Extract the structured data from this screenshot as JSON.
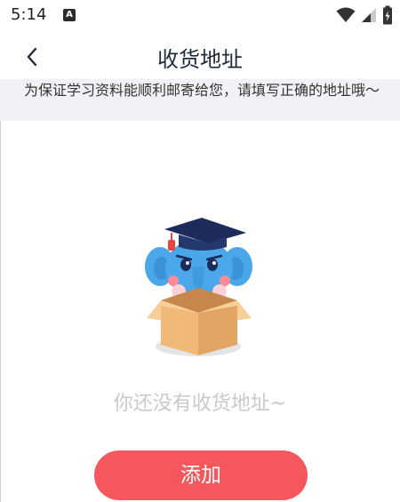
{
  "status_bar": {
    "time": "5:14",
    "notification_icon": "a-icon",
    "wifi_icon": "wifi-icon",
    "signal_icon": "signal-icon",
    "battery_icon": "battery-icon"
  },
  "header": {
    "title": "收货地址",
    "back_icon": "chevron-left-icon"
  },
  "notice": {
    "text": "为保证学习资料能顺利邮寄给您，请填写正确的地址哦～"
  },
  "empty_state": {
    "illustration": "elephant-in-box-graduation-cap",
    "message": "你还没有收货地址~"
  },
  "add_button": {
    "label": "添加"
  },
  "colors": {
    "accent": "#f4585c",
    "title": "#1d2b3a",
    "notice_bg": "#f1f2f5",
    "empty_text": "#c6c9ce",
    "elephant": "#4aa7ea",
    "box": "#f3c183",
    "cap": "#1c2b5a",
    "tassel": "#e8453c"
  }
}
